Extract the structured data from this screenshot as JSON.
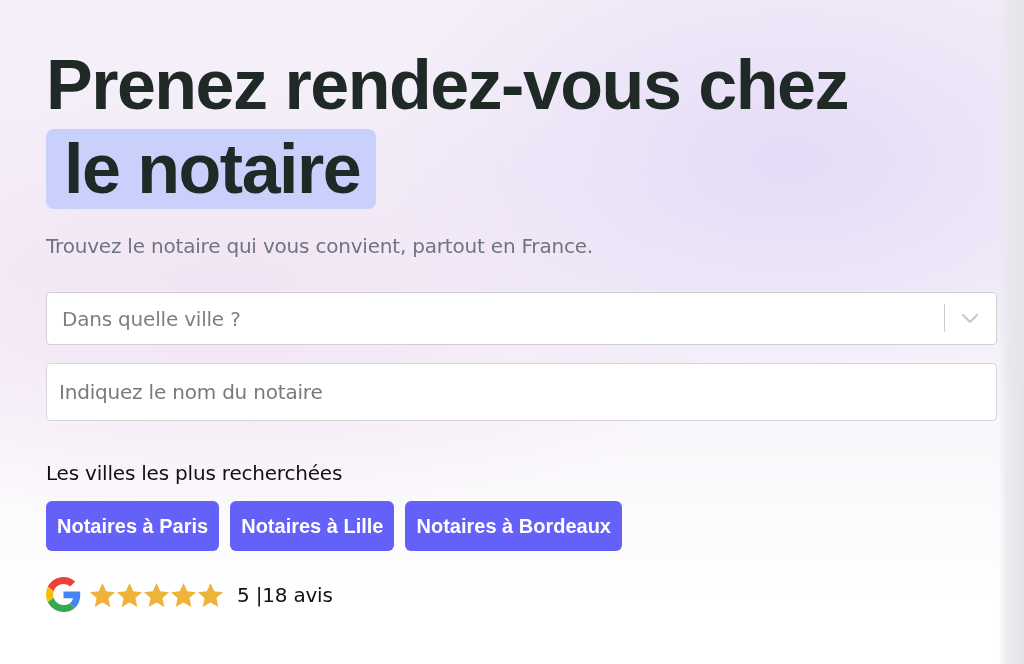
{
  "hero": {
    "title": "Prenez rendez-vous chez",
    "title_highlight": "le notaire",
    "subtitle": "Trouvez le notaire qui vous convient, partout en France."
  },
  "search": {
    "city_select": {
      "placeholder": "Dans quelle ville ?"
    },
    "name_field": {
      "placeholder": "Indiquez le nom du notaire"
    }
  },
  "popular_cities": {
    "heading": "Les villes les plus recherchées",
    "links": [
      "Notaires à Paris",
      "Notaires à Lille",
      "Notaires à Bordeaux"
    ]
  },
  "rating": {
    "stars": 5,
    "text": "5 |18 avis"
  }
}
